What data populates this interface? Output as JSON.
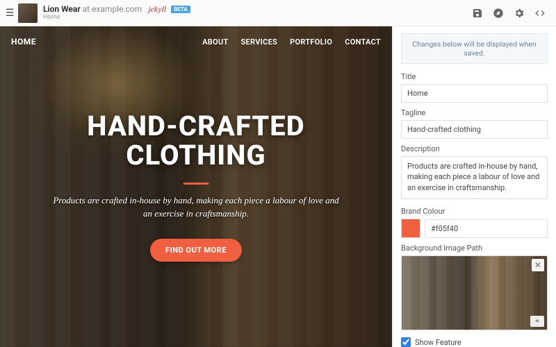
{
  "topbar": {
    "site_name": "Lion Wear",
    "at": "at",
    "domain": "example.com",
    "platform": "jekyll",
    "beta_badge": "BETA",
    "breadcrumb": "Home"
  },
  "nav": {
    "home": "HOME",
    "items": [
      "ABOUT",
      "SERVICES",
      "PORTFOLIO",
      "CONTACT"
    ]
  },
  "hero": {
    "headline": "HAND-CRAFTED CLOTHING",
    "tagline": "Products are crafted in-house by hand, making each piece a labour of love and an exercise in craftsmanship.",
    "cta": "FIND OUT MORE"
  },
  "panel": {
    "notice": "Changes below will be displayed when saved.",
    "fields": {
      "title": {
        "label": "Title",
        "value": "Home"
      },
      "tagline": {
        "label": "Tagline",
        "value": "Hand-crafted clothing"
      },
      "description": {
        "label": "Description",
        "value": "Products are crafted in-house by hand, making each piece a labour of love and an exercise in craftsmanship."
      },
      "brand_colour": {
        "label": "Brand Colour",
        "value": "#f05f40"
      },
      "bg_image": {
        "label": "Background Image Path"
      },
      "show_feature": {
        "label": "Show Feature",
        "checked": true
      }
    }
  }
}
